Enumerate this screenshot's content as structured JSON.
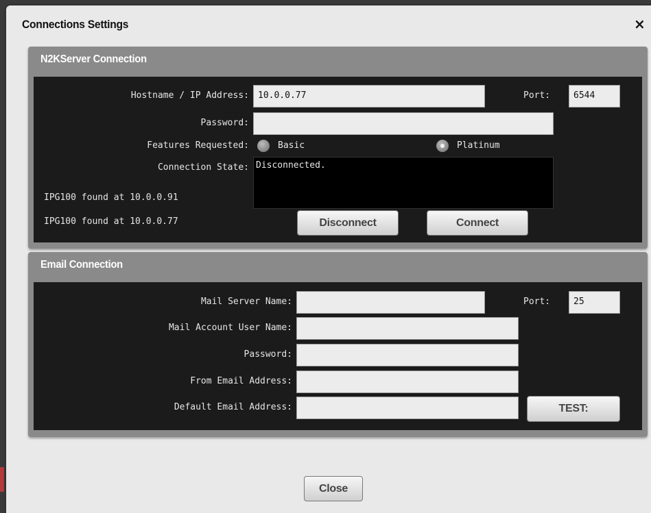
{
  "dialog": {
    "title": "Connections Settings",
    "close_icon": "×"
  },
  "n2k": {
    "title": "N2KServer Connection",
    "hostname_label": "Hostname / IP Address:",
    "hostname_value": "10.0.0.77",
    "port_label": "Port:",
    "port_value": "6544",
    "password_label": "Password:",
    "password_value": "",
    "features_label": "Features Requested:",
    "feature_basic": "Basic",
    "feature_platinum": "Platinum",
    "features_selected": "Platinum",
    "state_label": "Connection State:",
    "state_value": "Disconnected.",
    "found_devices": [
      "IPG100 found at 10.0.0.91",
      "IPG100 found at 10.0.0.77"
    ],
    "disconnect_label": "Disconnect",
    "connect_label": "Connect"
  },
  "email": {
    "title": "Email Connection",
    "server_label": "Mail Server Name:",
    "server_value": "",
    "port_label": "Port:",
    "port_value": "25",
    "user_label": "Mail Account User Name:",
    "user_value": "",
    "password_label": "Password:",
    "password_value": "",
    "from_label": "From Email Address:",
    "from_value": "",
    "default_label": "Default Email Address:",
    "default_value": "",
    "test_label": "TEST:"
  },
  "footer": {
    "close_label": "Close"
  }
}
